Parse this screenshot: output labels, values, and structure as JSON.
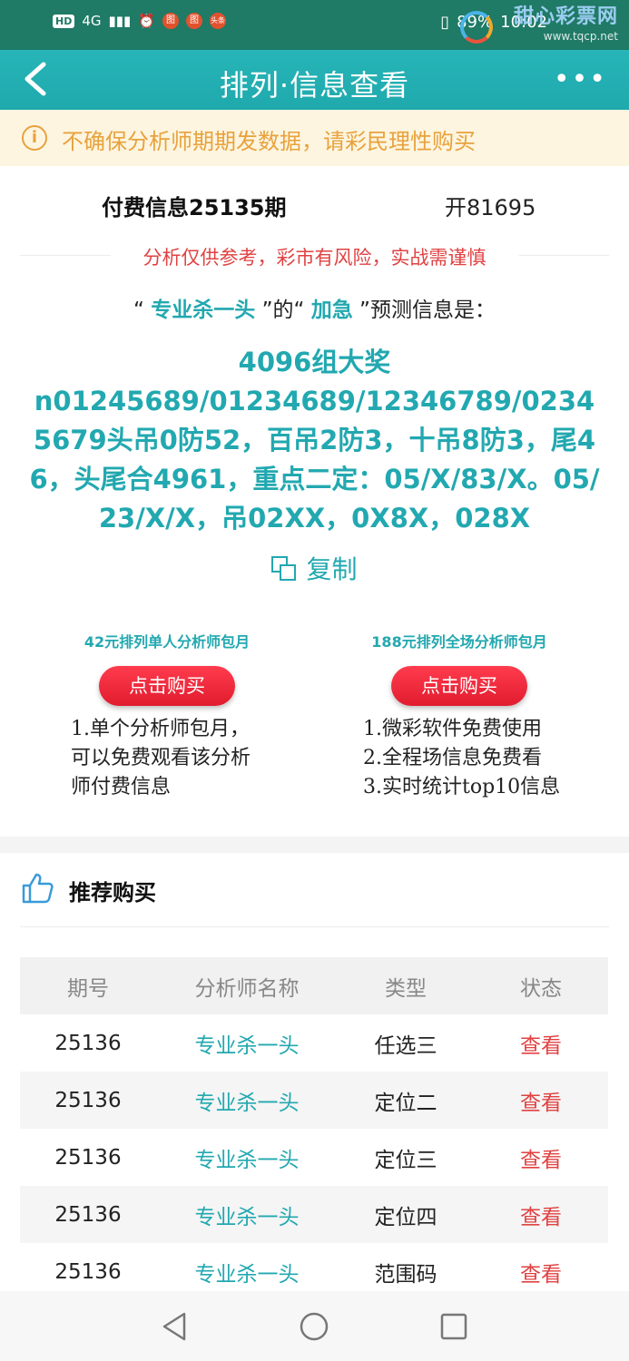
{
  "status_bar": {
    "hd": "HD",
    "signal": "4G",
    "time": "10:02",
    "battery": "89%",
    "dot_a": "图",
    "dot_b": "图",
    "dot_c": "头条"
  },
  "watermark": {
    "brand": "甜心彩票网",
    "url": "www.tqcp.net"
  },
  "header": {
    "title": "排列·信息查看",
    "more": "•••"
  },
  "notice": {
    "text": "不确保分析师期期发数据，请彩民理性购买"
  },
  "period": {
    "title": "付费信息25135期",
    "open_result": "开81695"
  },
  "risk_text": "分析仅供参考，彩市有风险，实战需谨慎",
  "prediction": {
    "prefix": "“",
    "analyst": "专业杀一头",
    "mid": "”的“",
    "urgency": "加急",
    "suffix": "”预测信息是："
  },
  "content": {
    "line1": "4096组大奖",
    "line2": "n01245689/01234689/12346789/02345679头吊0防52，百吊2防3，十吊8防3，尾46，头尾合4961，重点二定：05/X/83/X。05/23/X/X，吊02XX，0X8X，028X"
  },
  "copy_label": "复制",
  "packages": [
    {
      "title": "42元排列单人分析师包月",
      "button": "点击购买",
      "desc": [
        "1.单个分析师包月，",
        "可以免费观看该分析",
        "师付费信息"
      ]
    },
    {
      "title": "188元排列全场分析师包月",
      "button": "点击购买",
      "desc": [
        "1.微彩软件免费使用",
        "2.全程场信息免费看",
        "3.实时统计top10信息"
      ]
    }
  ],
  "recommend": {
    "title": "推荐购买",
    "columns": [
      "期号",
      "分析师名称",
      "类型",
      "状态"
    ],
    "rows": [
      {
        "period": "25136",
        "analyst": "专业杀一头",
        "type": "任选三",
        "status": "查看"
      },
      {
        "period": "25136",
        "analyst": "专业杀一头",
        "type": "定位二",
        "status": "查看"
      },
      {
        "period": "25136",
        "analyst": "专业杀一头",
        "type": "定位三",
        "status": "查看"
      },
      {
        "period": "25136",
        "analyst": "专业杀一头",
        "type": "定位四",
        "status": "查看"
      },
      {
        "period": "25136",
        "analyst": "专业杀一头",
        "type": "范围码",
        "status": "查看"
      }
    ]
  },
  "icons": {
    "back": "back-arrow-icon",
    "warn": "warning-circle-icon",
    "copy": "copy-icon",
    "thumb": "thumbs-up-icon",
    "nav_back": "nav-back-triangle-icon",
    "nav_home": "nav-home-circle-icon",
    "nav_recent": "nav-recents-square-icon"
  },
  "colors": {
    "teal": "#22a8b0",
    "header": "#1fa9ad",
    "red": "#e04242",
    "notice_bg": "#fdf5e0",
    "notice_fg": "#e8a23c"
  }
}
